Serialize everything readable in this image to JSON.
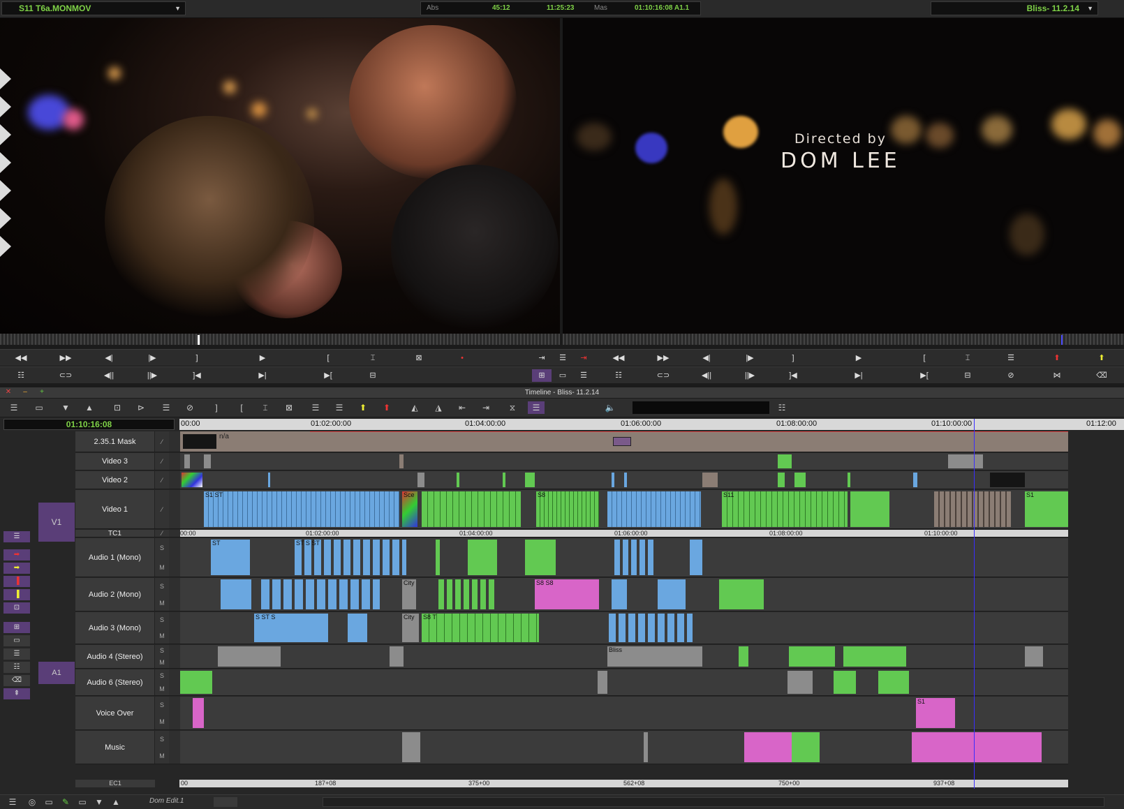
{
  "top": {
    "clip_name": "S11 T6a.MONMOV",
    "abs_label": "Abs",
    "abs_value": "45:12",
    "tc1": "11:25:23",
    "mas_label": "Mas",
    "mas_value": "01:10:16:08 A1.1",
    "sequence": "Bliss- 11.2.14"
  },
  "record": {
    "line1": "Directed by",
    "line2": "DOM LEE"
  },
  "timeline": {
    "title": "Timeline - Bliss- 11.2.14",
    "timecode": "01:10:16:08",
    "ruler": [
      "00:00",
      "01:02:00:00",
      "01:04:00:00",
      "01:06:00:00",
      "01:08:00:00",
      "01:10:00:00",
      "01:12:00"
    ],
    "tc_ruler": [
      "00:00",
      "01:02:00:00",
      "01:04:00:00",
      "01:06:00:00",
      "01:08:00:00",
      "01:10:00:00"
    ],
    "ec_ruler": [
      "00",
      "187+08",
      "375+00",
      "562+08",
      "750+00",
      "937+08"
    ],
    "tracks": {
      "mask": "2.35.1 Mask",
      "mask_clip": "n/a",
      "v3": "Video 3",
      "v2": "Video 2",
      "v1": "Video 1",
      "v1_patch": "V1",
      "tc1": "TC1",
      "a1": "Audio 1 (Mono)",
      "a2": "Audio 2 (Mono)",
      "a3": "Audio 3 (Mono)",
      "a4": "Audio 4 (Stereo)",
      "a1_patch": "A1",
      "a6": "Audio 6 (Stereo)",
      "vo": "Voice Over",
      "music": "Music",
      "ec1": "EC1"
    },
    "clip_labels": {
      "s8": "S8",
      "s11": "S11",
      "city": "City",
      "scene": "Sce",
      "n_a": "n/a",
      "bliss": "Bliss",
      "s1": "S1"
    }
  },
  "bottom": {
    "workspace": "Dom Edit.1"
  },
  "colors": {
    "video_blue": "#6aa7e0",
    "video_green": "#62c952",
    "audio_pink": "#d865c8",
    "accent_purple": "#5a3e78",
    "timecode_green": "#7fd247"
  }
}
